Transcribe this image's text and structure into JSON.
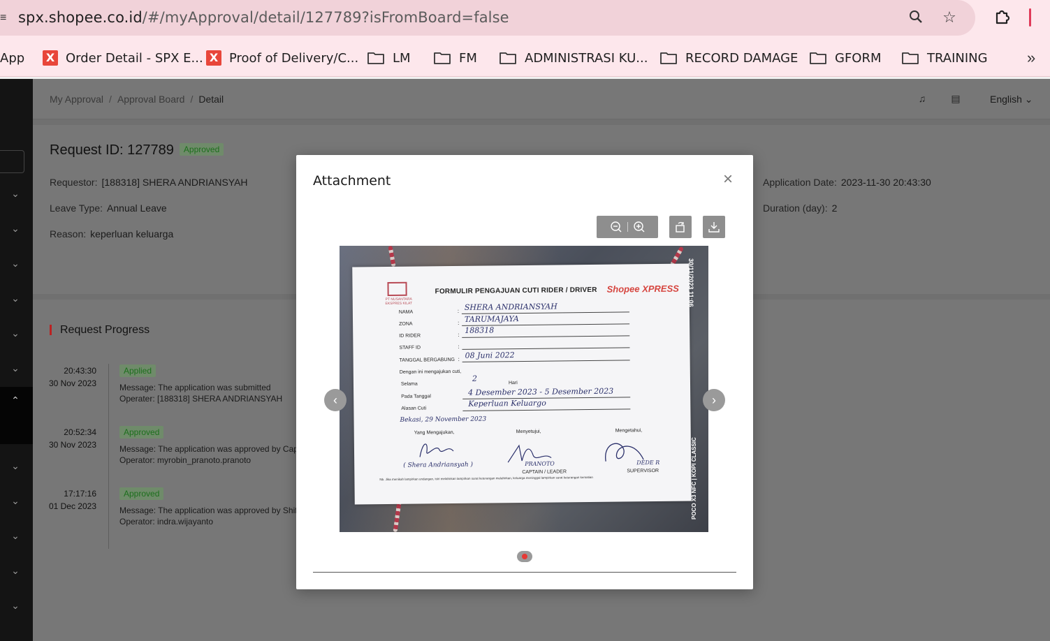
{
  "browser": {
    "url_host": "spx.shopee.co.id",
    "url_path": "/#/myApproval/detail/127789?isFromBoard=false",
    "bookmarks": [
      {
        "label": "App",
        "type": "text"
      },
      {
        "label": "Order Detail - SPX E...",
        "type": "x"
      },
      {
        "label": "Proof of Delivery/C...",
        "type": "x"
      },
      {
        "label": "LM",
        "type": "folder"
      },
      {
        "label": "FM",
        "type": "folder"
      },
      {
        "label": "ADMINISTRASI KU...",
        "type": "folder"
      },
      {
        "label": "RECORD DAMAGE",
        "type": "folder"
      },
      {
        "label": "GFORM",
        "type": "folder"
      },
      {
        "label": "TRAINING",
        "type": "folder"
      }
    ],
    "more_icon": "double-chevron-right-icon",
    "accent": "#fde7ec"
  },
  "breadcrumb": {
    "items": [
      "My Approval",
      "Approval Board",
      "Detail"
    ],
    "separator": "/"
  },
  "header": {
    "language": "English"
  },
  "request": {
    "title": "Request ID: 127789",
    "status": "Approved",
    "requestor_label": "Requestor:",
    "requestor_value": "[188318] SHERA ANDRIANSYAH",
    "leave_type_label": "Leave Type:",
    "leave_type_value": "Annual Leave",
    "reason_label": "Reason:",
    "reason_value": "keperluan keluarga",
    "application_date_label": "Application Date:",
    "application_date_value": "2023-11-30 20:43:30",
    "duration_label": "Duration (day):",
    "duration_value": "2"
  },
  "progress": {
    "title": "Request Progress",
    "entries": [
      {
        "time": "20:43:30",
        "date": "30 Nov 2023",
        "status": "Applied",
        "message": "Message:  The application was submitted",
        "operator": "Operater:  [188318] SHERA ANDRIANSYAH"
      },
      {
        "time": "20:52:34",
        "date": "30 Nov 2023",
        "status": "Approved",
        "message": "Message:  The application was approved by Cap",
        "operator": "Operator:  myrobin_pranoto.pranoto"
      },
      {
        "time": "17:17:16",
        "date": "01 Dec 2023",
        "status": "Approved",
        "message": "Message:  The application was approved by Shif",
        "operator": "Operator:  indra.wijayanto"
      }
    ]
  },
  "modal": {
    "title": "Attachment",
    "close_icon": "close-icon",
    "tools": [
      "zoom-out-icon",
      "zoom-in-icon",
      "rotate-icon",
      "download-icon"
    ]
  },
  "document": {
    "company": "PT NUSANTARA EKSPRES KILAT",
    "title": "FORMULIR PENGAJUAN CUTI RIDER / DRIVER",
    "brand": "Shopee XPRESS",
    "fields": [
      {
        "label": "NAMA",
        "value": "SHERA ANDRIANSYAH"
      },
      {
        "label": "ZONA",
        "value": "TARUMAJAYA"
      },
      {
        "label": "ID RIDER",
        "value": "188318"
      },
      {
        "label": "STAFF ID",
        "value": ""
      },
      {
        "label": "TANGGAL BERGABUNG",
        "value": "08 Juni 2022"
      }
    ],
    "intro": "Dengan ini mengajukan cuti,",
    "selama_label": "Selama",
    "selama_value": "2",
    "selama_unit": "Hari",
    "pada_label": "Pada Tanggal",
    "pada_value": "4 Desember 2023 - 5 Desember 2023",
    "alasan_label": "Alasan Cuti",
    "alasan_value": "Keperluan Keluargo",
    "place_date": "Bekasi, 29 November 2023",
    "sign_1": "Yang Mengajukan,",
    "sign_2": "Menyetujui,",
    "sign_3": "Mengetahui,",
    "name_1": "( Shera Andriansyah )",
    "name_2": "PRANOTO",
    "name_3": "DEDE R",
    "role_2": "CAPTAIN / LEADER",
    "role_3": "SUPERVISOR",
    "note": "Nb. Jika menikah lampirkan undangan, istri melahirkan lampirkan surat keterangan melahirkan, keluarga meninggal lampirkan surat keterangan kematian",
    "stamp_date": "30/11/2023  11:06",
    "stamp_device": "POCO X3 NFC | KOPI CLASSIC"
  }
}
